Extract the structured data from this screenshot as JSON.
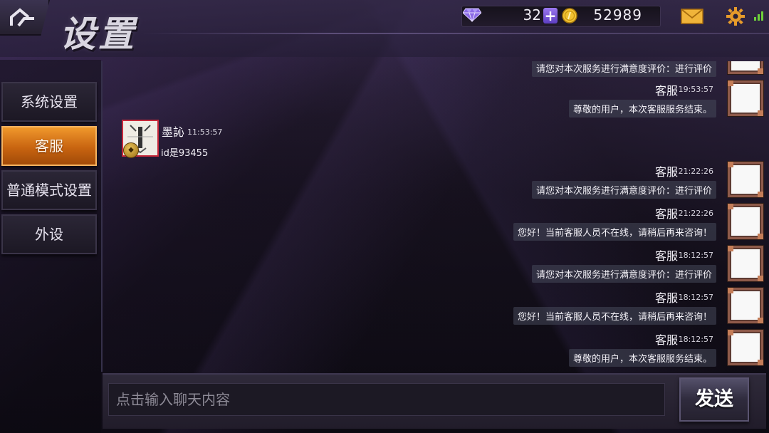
{
  "header": {
    "title": "设置",
    "gems": "32",
    "plus_label": "+",
    "coins": "52989"
  },
  "icons": {
    "home": "home-icon",
    "gem": "diamond-icon",
    "coin": "gold-coin-icon",
    "mail": "mail-icon",
    "settings": "gear-icon",
    "signal": "signal-icon"
  },
  "sidebar": {
    "items": [
      {
        "label": "系统设置",
        "active": false
      },
      {
        "label": "客服",
        "active": true
      },
      {
        "label": "普通模式设置",
        "active": false
      },
      {
        "label": "外设",
        "active": false
      }
    ]
  },
  "chat": {
    "messages": [
      {
        "from": "support",
        "name": "",
        "time": "",
        "text": "请您对本次服务进行满意度评价：进行评价"
      },
      {
        "from": "support",
        "name": "客服",
        "time": "19:53:57",
        "text": "尊敬的用户，本次客服服务结束。"
      },
      {
        "from": "user",
        "name": "墨訫",
        "time": "11:53:57",
        "text": "id是93455"
      },
      {
        "from": "support",
        "name": "客服",
        "time": "21:22:26",
        "text": "请您对本次服务进行满意度评价：进行评价"
      },
      {
        "from": "support",
        "name": "客服",
        "time": "21:22:26",
        "text": "您好！当前客服人员不在线，请稍后再来咨询！"
      },
      {
        "from": "support",
        "name": "客服",
        "time": "18:12:57",
        "text": "请您对本次服务进行满意度评价：进行评价"
      },
      {
        "from": "support",
        "name": "客服",
        "time": "18:12:57",
        "text": "您好！当前客服人员不在线，请稍后再来咨询！"
      },
      {
        "from": "support",
        "name": "客服",
        "time": "18:12:57",
        "text": "尊敬的用户，本次客服服务结束。"
      }
    ]
  },
  "input": {
    "placeholder": "点击输入聊天内容",
    "value": "",
    "send_label": "发送"
  },
  "colors": {
    "accent_orange": "#e07a1c",
    "avatar_border_red": "#c6283a",
    "gem_purple": "#7b5cd8",
    "coin_gold": "#f1c232",
    "signal_green": "#6ed13a"
  }
}
